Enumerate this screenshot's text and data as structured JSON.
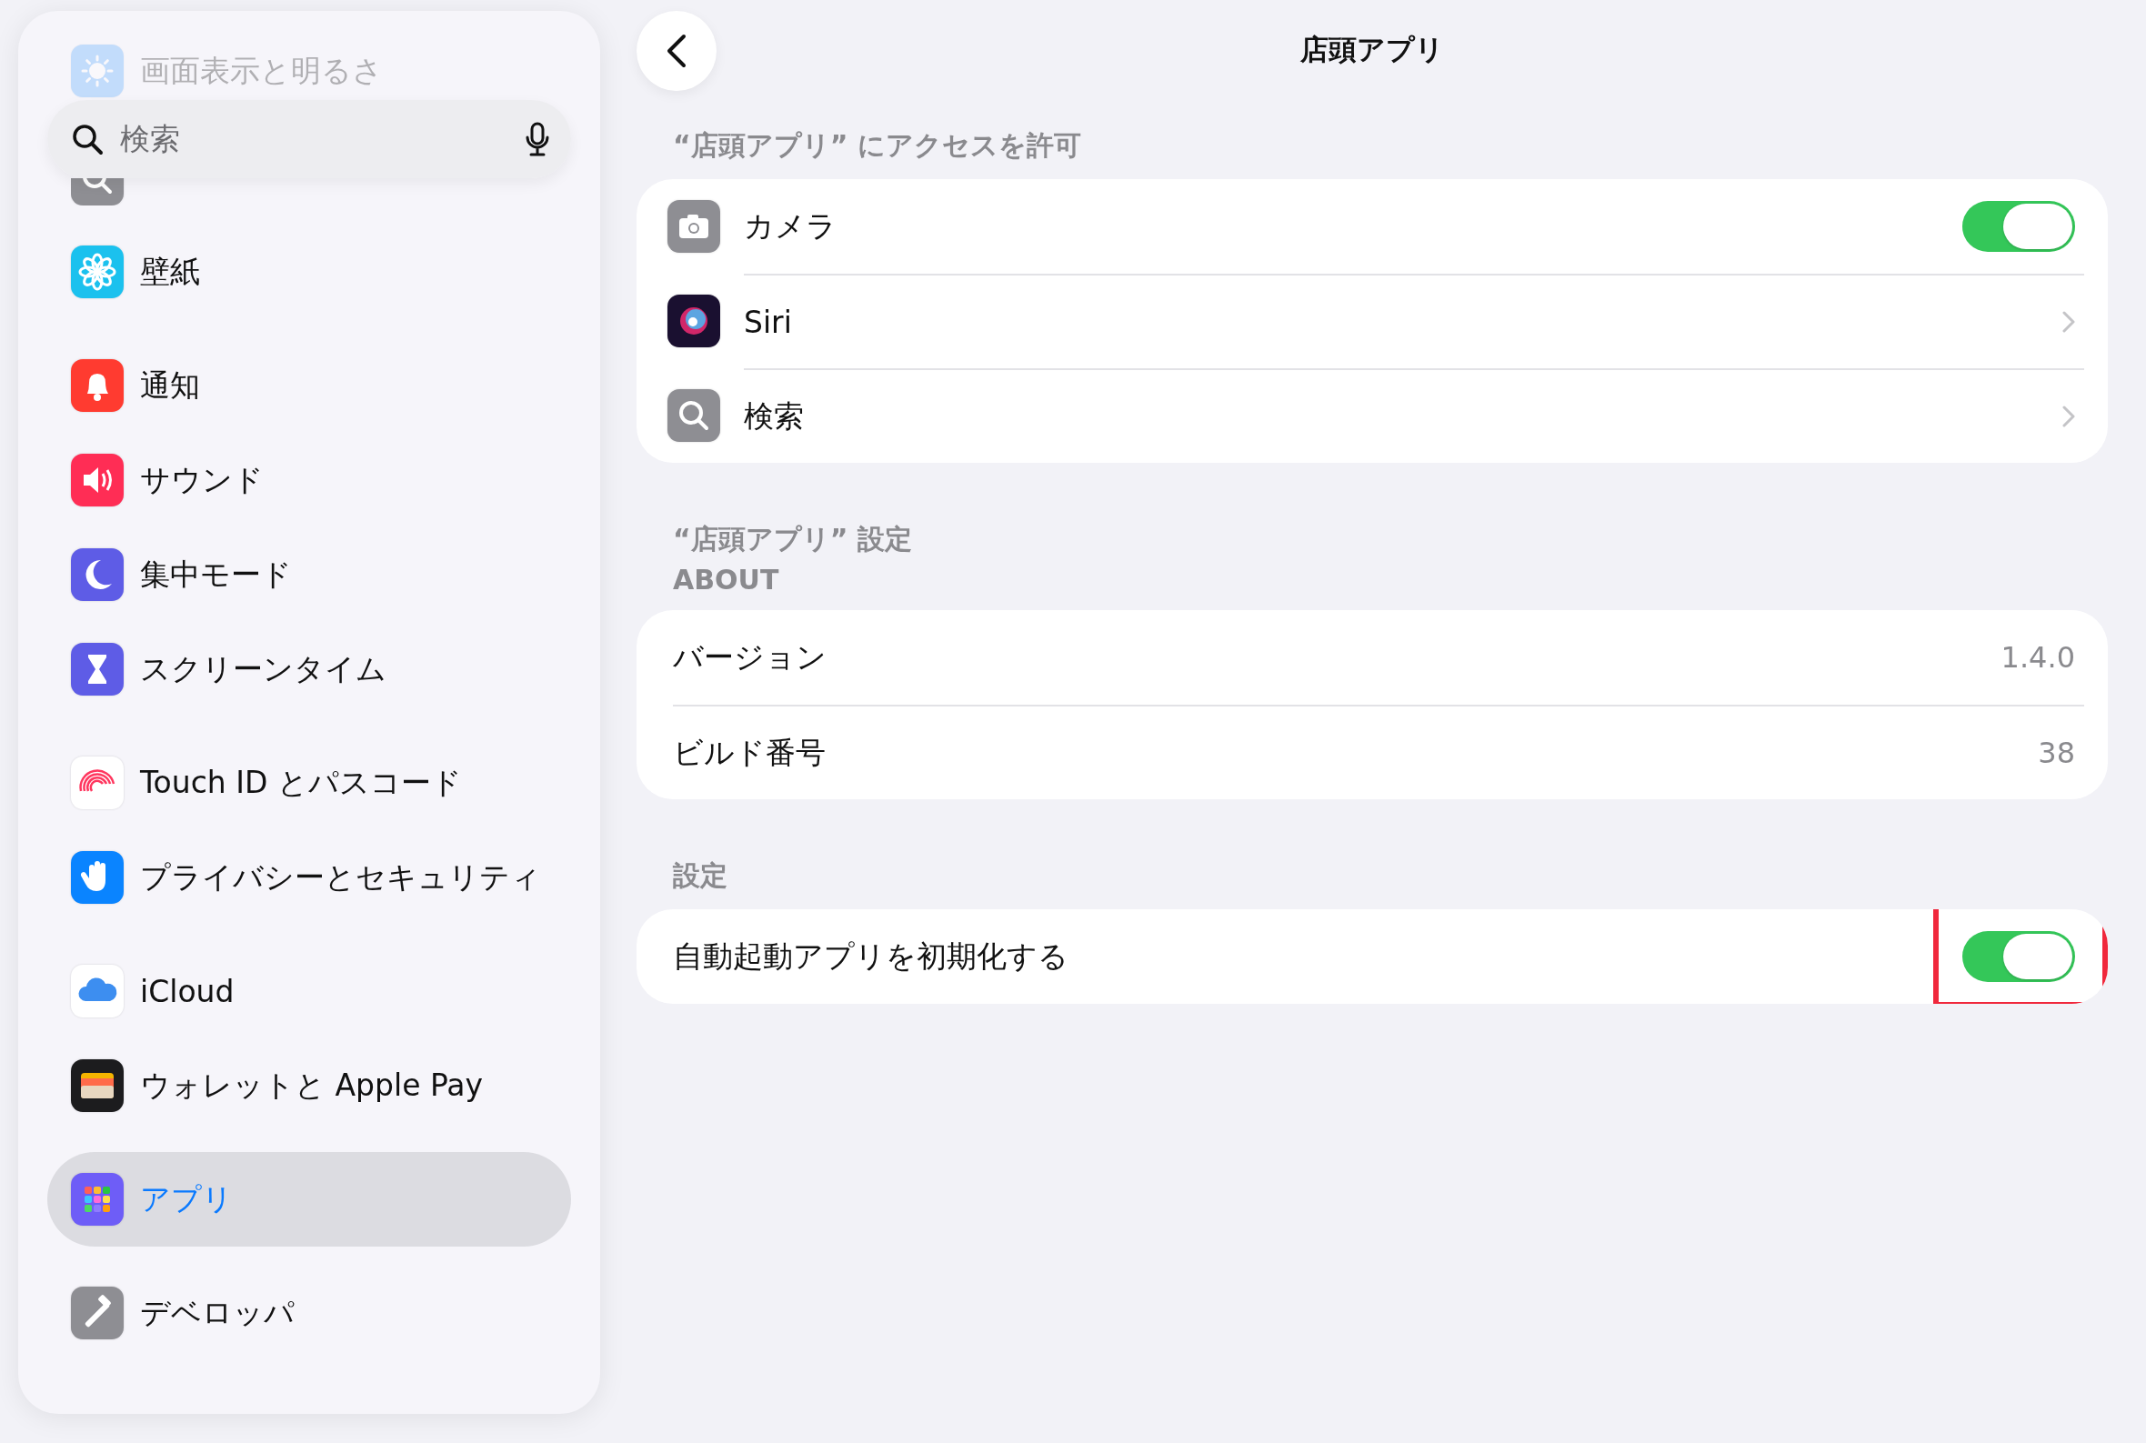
{
  "sidebar": {
    "faded_item": {
      "label": "画面表示と明るさ",
      "kind": "display"
    },
    "search": {
      "placeholder": "検索"
    },
    "covered_item": {
      "kind": "search"
    },
    "groups": [
      [
        {
          "label": "壁紙",
          "kind": "wallpaper",
          "selected": false
        }
      ],
      [
        {
          "label": "通知",
          "kind": "notifications",
          "selected": false
        },
        {
          "label": "サウンド",
          "kind": "sound",
          "selected": false
        },
        {
          "label": "集中モード",
          "kind": "focus",
          "selected": false
        },
        {
          "label": "スクリーンタイム",
          "kind": "screentime",
          "selected": false
        }
      ],
      [
        {
          "label": "Touch ID とパスコード",
          "kind": "touchid",
          "selected": false
        },
        {
          "label": "プライバシーとセキュリティ",
          "kind": "privacy",
          "selected": false
        }
      ],
      [
        {
          "label": "iCloud",
          "kind": "icloud",
          "selected": false
        },
        {
          "label": "ウォレットと Apple Pay",
          "kind": "wallet",
          "selected": false
        }
      ],
      [
        {
          "label": "アプリ",
          "kind": "apps",
          "selected": true
        }
      ],
      [
        {
          "label": "デベロッパ",
          "kind": "developer",
          "selected": false
        }
      ]
    ]
  },
  "nav": {
    "title": "店頭アプリ"
  },
  "sections": [
    {
      "header": [
        "“店頭アプリ” にアクセスを許可"
      ],
      "rows": [
        {
          "kind": "toggle",
          "label": "カメラ",
          "on": true
        },
        {
          "kind": "link",
          "label": "Siri"
        },
        {
          "kind": "link",
          "label": "検索"
        }
      ]
    },
    {
      "header": [
        "“店頭アプリ” 設定",
        "ABOUT"
      ],
      "rows": [
        {
          "kind": "value",
          "label": "バージョン",
          "value": "1.4.0"
        },
        {
          "kind": "value",
          "label": "ビルド番号",
          "value": "38"
        }
      ]
    },
    {
      "header": [
        "設定"
      ],
      "rows": [
        {
          "kind": "toggle",
          "label": "自動起動アプリを初期化する",
          "on": true,
          "highlighted": true
        }
      ]
    }
  ]
}
